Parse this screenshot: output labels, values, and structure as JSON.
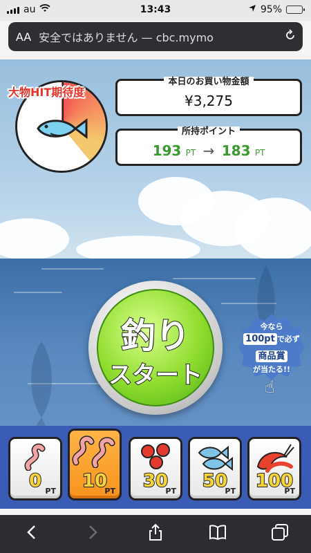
{
  "status_bar": {
    "carrier": "au",
    "time": "13:43",
    "battery": "95%",
    "battery_level": 0.95,
    "location_icon": "location-arrow-icon"
  },
  "browser": {
    "aa_label": "AA",
    "url_text": "安全ではありません — cbc.mymo",
    "reload_icon": "reload-icon"
  },
  "gauge": {
    "label": "大物HIT期待度",
    "icon": "fish-icon",
    "level": 0.39,
    "colors": [
      "#f05050",
      "#f79060",
      "#f4c86e"
    ]
  },
  "purchase": {
    "label": "本日のお買い物金額",
    "amount": "¥3,275"
  },
  "points": {
    "label": "所持ポイント",
    "current": "193",
    "after": "183",
    "unit": "PT",
    "arrow": "→"
  },
  "start_button": {
    "line1": "釣り",
    "line2": "スタート",
    "color": "#8fdc2e"
  },
  "promo": {
    "line1": "今なら",
    "line2_highlight": "100pt",
    "line2_rest": "で必ず",
    "line3": "商品賞",
    "line4": "が当たる!!"
  },
  "baits": [
    {
      "id": "worm",
      "value": "0",
      "unit": "PT",
      "icon": "worm-icon",
      "selected": false
    },
    {
      "id": "worms",
      "value": "10",
      "unit": "PT",
      "icon": "worms-icon",
      "selected": true
    },
    {
      "id": "beads",
      "value": "30",
      "unit": "PT",
      "icon": "red-beads-icon",
      "selected": false
    },
    {
      "id": "fish",
      "value": "50",
      "unit": "PT",
      "icon": "small-fish-icon",
      "selected": false
    },
    {
      "id": "shrimp",
      "value": "100",
      "unit": "PT",
      "icon": "shrimp-icon",
      "selected": false
    }
  ],
  "toolbar": {
    "back_icon": "back-arrow-icon",
    "forward_icon": "forward-arrow-icon",
    "share_icon": "share-icon",
    "bookmarks_icon": "bookmarks-icon",
    "tabs_icon": "tabs-icon"
  }
}
